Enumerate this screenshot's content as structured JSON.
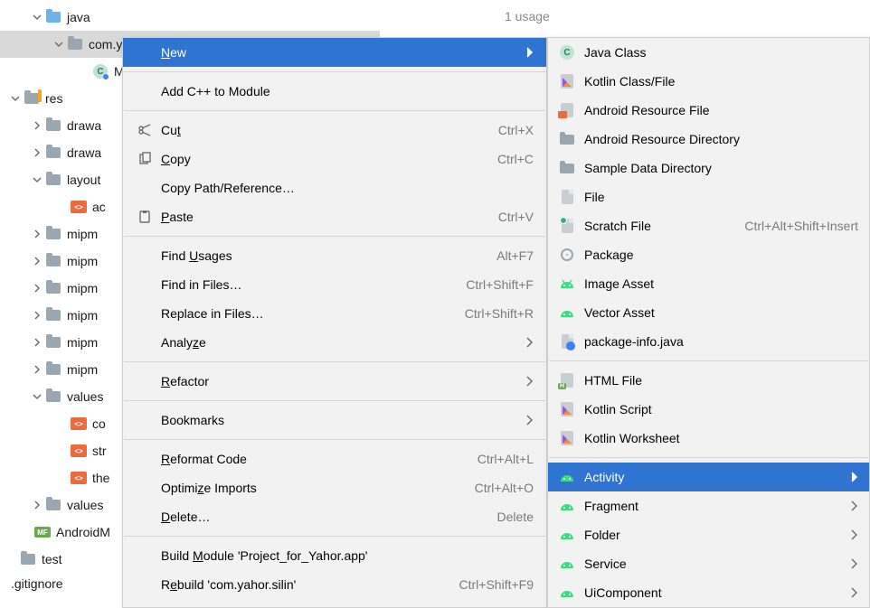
{
  "usages": "1 usage",
  "tree": {
    "java": "java",
    "com_y": "com.y",
    "ma": "Ma",
    "res": "res",
    "drawa1": "drawa",
    "drawa2": "drawa",
    "layout": "layout",
    "act": "ac",
    "mipm1": "mipm",
    "mipm2": "mipm",
    "mipm3": "mipm",
    "mipm4": "mipm",
    "mipm5": "mipm",
    "mipm6": "mipm",
    "values": "values",
    "co": "co",
    "str": "str",
    "the": "the",
    "values2": "values",
    "manifest": "AndroidM",
    "test": "test",
    "gitignore": ".gitignore"
  },
  "menu1": {
    "new": "New",
    "addcpp": "Add C++ to Module",
    "cut": "Cut",
    "cut_sc": "Ctrl+X",
    "copy": "Copy",
    "copy_sc": "Ctrl+C",
    "copypath": "Copy Path/Reference…",
    "paste": "Paste",
    "paste_sc": "Ctrl+V",
    "findusages": "Find Usages",
    "findusages_sc": "Alt+F7",
    "findfiles": "Find in Files…",
    "findfiles_sc": "Ctrl+Shift+F",
    "replacefiles": "Replace in Files…",
    "replacefiles_sc": "Ctrl+Shift+R",
    "analyze": "Analyze",
    "refactor": "Refactor",
    "bookmarks": "Bookmarks",
    "reformat": "Reformat Code",
    "reformat_sc": "Ctrl+Alt+L",
    "optimize": "Optimize Imports",
    "optimize_sc": "Ctrl+Alt+O",
    "delete": "Delete…",
    "delete_sc": "Delete",
    "buildmodule": "Build Module 'Project_for_Yahor.app'",
    "rebuild": "Rebuild 'com.yahor.silin'",
    "rebuild_sc": "Ctrl+Shift+F9"
  },
  "menu2": {
    "javaclass": "Java Class",
    "kotlin": "Kotlin Class/File",
    "resfile": "Android Resource File",
    "resdir": "Android Resource Directory",
    "sampledir": "Sample Data Directory",
    "file": "File",
    "scratch": "Scratch File",
    "scratch_sc": "Ctrl+Alt+Shift+Insert",
    "package": "Package",
    "imageasset": "Image Asset",
    "vectorasset": "Vector Asset",
    "pkginfo": "package-info.java",
    "htmlfile": "HTML File",
    "kotlinscript": "Kotlin Script",
    "kotlinws": "Kotlin Worksheet",
    "activity": "Activity",
    "fragment": "Fragment",
    "folder": "Folder",
    "service": "Service",
    "uicomp": "UiComponent"
  }
}
